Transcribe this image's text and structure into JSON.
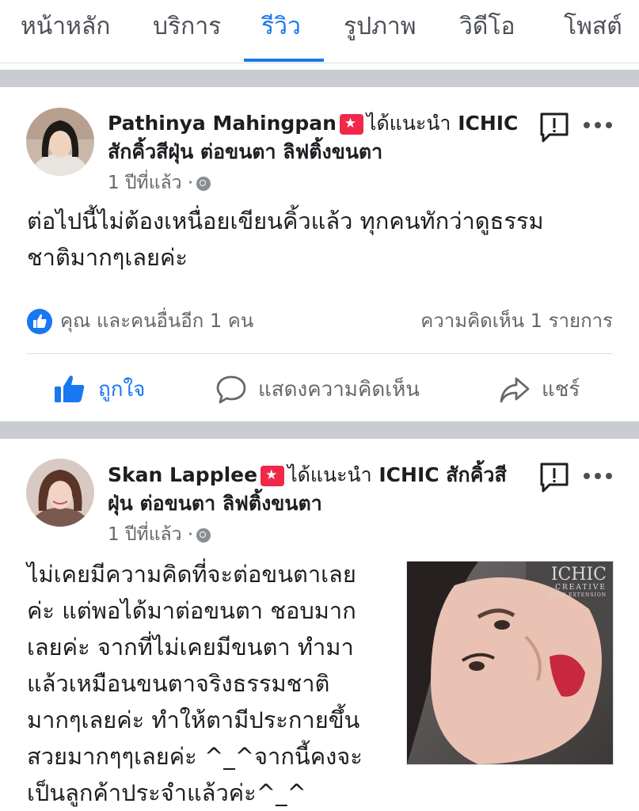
{
  "tabs": [
    {
      "label": "หน้าหลัก"
    },
    {
      "label": "บริการ"
    },
    {
      "label": "รีวิว",
      "active": true
    },
    {
      "label": "รูปภาพ"
    },
    {
      "label": "วิดีโอ"
    },
    {
      "label": "โพสต์"
    }
  ],
  "posts": [
    {
      "author": "Pathinya Mahingpan",
      "recommend_text": "ได้แนะนำ",
      "page_line1": "ICHIC",
      "page_line2": "สักคิ้วสีฝุ่น ต่อขนตา ลิฟติ้งขนตา",
      "time": "1 ปีที่แล้ว ·",
      "text_line1": "ต่อไปนี้ไม่ต้องเหนื่อยเขียนคิ้วแล้ว ทุกคนทักว่าดูธรรม",
      "text_line2": "ชาติมากๆเลยค่ะ",
      "likes": "คุณ และคนอื่นอีก 1 คน",
      "comments": "ความคิดเห็น 1 รายการ",
      "actions": {
        "like": "ถูกใจ",
        "comment": "แสดงความคิดเห็น",
        "share": "แชร์"
      }
    },
    {
      "author": "Skan Lapplee",
      "recommend_text": "ได้แนะนำ",
      "page_line1": "ICHIC สักคิ้วสี",
      "page_line2": "ฝุ่น ต่อขนตา ลิฟติ้งขนตา",
      "time": "1 ปีที่แล้ว ·",
      "text_lines": [
        "ไม่เคยมีความคิดที่จะต่อขนตาเลย",
        "ค่ะ แต่พอได้มาต่อขนตา ชอบมาก",
        "เลยค่ะ จากที่ไม่เคยมีขนตา ทำมา",
        "แล้วเหมือนขนตาจริงธรรมชาติ",
        "มากๆเลยค่ะ ทำให้ตามีประกายขึ้น",
        "สวยมากๆๆเลยค่ะ ^_^จากนี้คงจะ",
        "เป็นลูกค้าประจำแล้วค่ะ^_^"
      ],
      "image_logo": "ICHIC",
      "image_logo_sub": "CREATIVE",
      "image_logo_sub2": "LASH EXTENSION"
    }
  ],
  "colors": {
    "accent": "#1877f2",
    "recommend": "#f0284a",
    "divider": "#c9ccd1"
  }
}
